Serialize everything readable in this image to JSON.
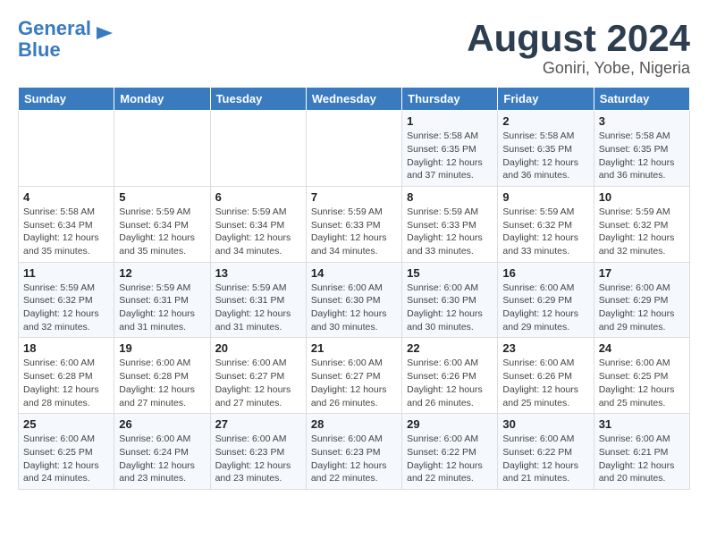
{
  "header": {
    "logo_line1": "General",
    "logo_line2": "Blue",
    "month_year": "August 2024",
    "location": "Goniri, Yobe, Nigeria"
  },
  "days_of_week": [
    "Sunday",
    "Monday",
    "Tuesday",
    "Wednesday",
    "Thursday",
    "Friday",
    "Saturday"
  ],
  "weeks": [
    [
      {
        "day": "",
        "detail": ""
      },
      {
        "day": "",
        "detail": ""
      },
      {
        "day": "",
        "detail": ""
      },
      {
        "day": "",
        "detail": ""
      },
      {
        "day": "1",
        "detail": "Sunrise: 5:58 AM\nSunset: 6:35 PM\nDaylight: 12 hours\nand 37 minutes."
      },
      {
        "day": "2",
        "detail": "Sunrise: 5:58 AM\nSunset: 6:35 PM\nDaylight: 12 hours\nand 36 minutes."
      },
      {
        "day": "3",
        "detail": "Sunrise: 5:58 AM\nSunset: 6:35 PM\nDaylight: 12 hours\nand 36 minutes."
      }
    ],
    [
      {
        "day": "4",
        "detail": "Sunrise: 5:58 AM\nSunset: 6:34 PM\nDaylight: 12 hours\nand 35 minutes."
      },
      {
        "day": "5",
        "detail": "Sunrise: 5:59 AM\nSunset: 6:34 PM\nDaylight: 12 hours\nand 35 minutes."
      },
      {
        "day": "6",
        "detail": "Sunrise: 5:59 AM\nSunset: 6:34 PM\nDaylight: 12 hours\nand 34 minutes."
      },
      {
        "day": "7",
        "detail": "Sunrise: 5:59 AM\nSunset: 6:33 PM\nDaylight: 12 hours\nand 34 minutes."
      },
      {
        "day": "8",
        "detail": "Sunrise: 5:59 AM\nSunset: 6:33 PM\nDaylight: 12 hours\nand 33 minutes."
      },
      {
        "day": "9",
        "detail": "Sunrise: 5:59 AM\nSunset: 6:32 PM\nDaylight: 12 hours\nand 33 minutes."
      },
      {
        "day": "10",
        "detail": "Sunrise: 5:59 AM\nSunset: 6:32 PM\nDaylight: 12 hours\nand 32 minutes."
      }
    ],
    [
      {
        "day": "11",
        "detail": "Sunrise: 5:59 AM\nSunset: 6:32 PM\nDaylight: 12 hours\nand 32 minutes."
      },
      {
        "day": "12",
        "detail": "Sunrise: 5:59 AM\nSunset: 6:31 PM\nDaylight: 12 hours\nand 31 minutes."
      },
      {
        "day": "13",
        "detail": "Sunrise: 5:59 AM\nSunset: 6:31 PM\nDaylight: 12 hours\nand 31 minutes."
      },
      {
        "day": "14",
        "detail": "Sunrise: 6:00 AM\nSunset: 6:30 PM\nDaylight: 12 hours\nand 30 minutes."
      },
      {
        "day": "15",
        "detail": "Sunrise: 6:00 AM\nSunset: 6:30 PM\nDaylight: 12 hours\nand 30 minutes."
      },
      {
        "day": "16",
        "detail": "Sunrise: 6:00 AM\nSunset: 6:29 PM\nDaylight: 12 hours\nand 29 minutes."
      },
      {
        "day": "17",
        "detail": "Sunrise: 6:00 AM\nSunset: 6:29 PM\nDaylight: 12 hours\nand 29 minutes."
      }
    ],
    [
      {
        "day": "18",
        "detail": "Sunrise: 6:00 AM\nSunset: 6:28 PM\nDaylight: 12 hours\nand 28 minutes."
      },
      {
        "day": "19",
        "detail": "Sunrise: 6:00 AM\nSunset: 6:28 PM\nDaylight: 12 hours\nand 27 minutes."
      },
      {
        "day": "20",
        "detail": "Sunrise: 6:00 AM\nSunset: 6:27 PM\nDaylight: 12 hours\nand 27 minutes."
      },
      {
        "day": "21",
        "detail": "Sunrise: 6:00 AM\nSunset: 6:27 PM\nDaylight: 12 hours\nand 26 minutes."
      },
      {
        "day": "22",
        "detail": "Sunrise: 6:00 AM\nSunset: 6:26 PM\nDaylight: 12 hours\nand 26 minutes."
      },
      {
        "day": "23",
        "detail": "Sunrise: 6:00 AM\nSunset: 6:26 PM\nDaylight: 12 hours\nand 25 minutes."
      },
      {
        "day": "24",
        "detail": "Sunrise: 6:00 AM\nSunset: 6:25 PM\nDaylight: 12 hours\nand 25 minutes."
      }
    ],
    [
      {
        "day": "25",
        "detail": "Sunrise: 6:00 AM\nSunset: 6:25 PM\nDaylight: 12 hours\nand 24 minutes."
      },
      {
        "day": "26",
        "detail": "Sunrise: 6:00 AM\nSunset: 6:24 PM\nDaylight: 12 hours\nand 23 minutes."
      },
      {
        "day": "27",
        "detail": "Sunrise: 6:00 AM\nSunset: 6:23 PM\nDaylight: 12 hours\nand 23 minutes."
      },
      {
        "day": "28",
        "detail": "Sunrise: 6:00 AM\nSunset: 6:23 PM\nDaylight: 12 hours\nand 22 minutes."
      },
      {
        "day": "29",
        "detail": "Sunrise: 6:00 AM\nSunset: 6:22 PM\nDaylight: 12 hours\nand 22 minutes."
      },
      {
        "day": "30",
        "detail": "Sunrise: 6:00 AM\nSunset: 6:22 PM\nDaylight: 12 hours\nand 21 minutes."
      },
      {
        "day": "31",
        "detail": "Sunrise: 6:00 AM\nSunset: 6:21 PM\nDaylight: 12 hours\nand 20 minutes."
      }
    ]
  ]
}
